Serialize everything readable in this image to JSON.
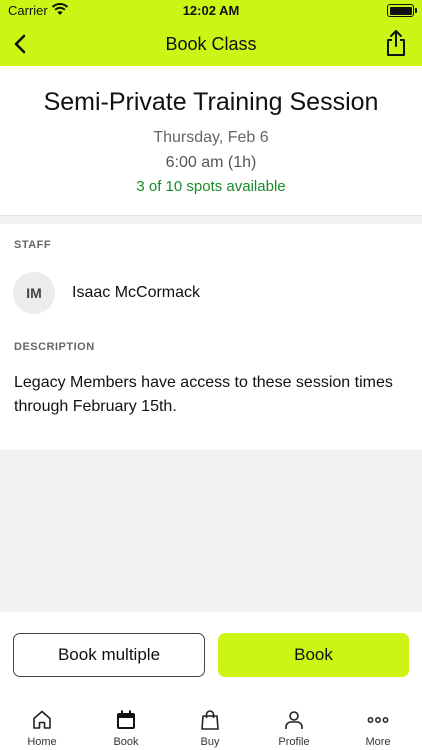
{
  "status_bar": {
    "carrier": "Carrier",
    "time": "12:02 AM"
  },
  "nav": {
    "title": "Book Class"
  },
  "session": {
    "name": "Semi-Private Training Session",
    "date": "Thursday, Feb 6",
    "time": "6:00 am (1h)",
    "availability": "3 of 10 spots available"
  },
  "staff": {
    "label": "STAFF",
    "initials": "IM",
    "name": "Isaac McCormack"
  },
  "description": {
    "label": "DESCRIPTION",
    "text": "Legacy Members have access to these session times through February 15th."
  },
  "actions": {
    "book_multiple": "Book multiple",
    "book": "Book"
  },
  "tabbar": {
    "items": [
      {
        "label": "Home",
        "icon": "home-icon"
      },
      {
        "label": "Book",
        "icon": "calendar-icon"
      },
      {
        "label": "Buy",
        "icon": "shopping-bag-icon"
      },
      {
        "label": "Profile",
        "icon": "person-icon"
      },
      {
        "label": "More",
        "icon": "more-icon"
      }
    ]
  },
  "colors": {
    "accent": "#ccf516",
    "availability": "#1a8a2a"
  }
}
